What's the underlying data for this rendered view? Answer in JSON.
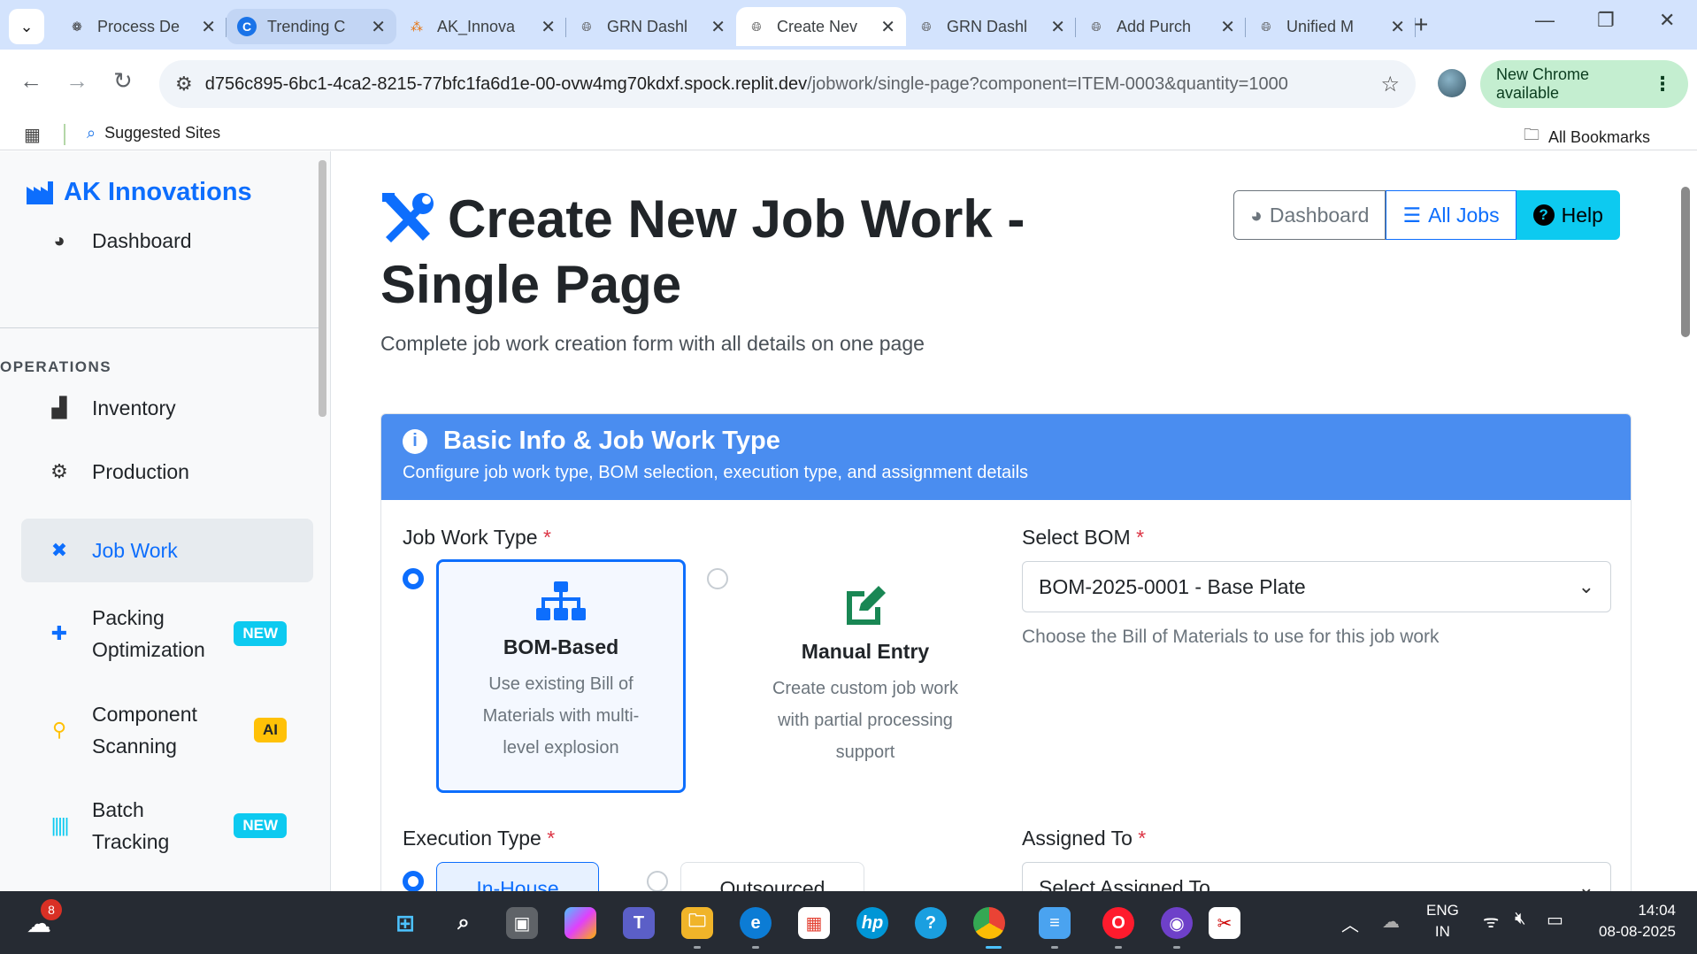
{
  "browser": {
    "tabs": [
      {
        "title": "Process De",
        "icon": "chatgpt-icon"
      },
      {
        "title": "Trending C",
        "icon": "c-logo-icon"
      },
      {
        "title": "AK_Innova",
        "icon": "figma-icon"
      },
      {
        "title": "GRN Dashl",
        "icon": "globe-icon"
      },
      {
        "title": "Create Nev",
        "icon": "globe-icon"
      },
      {
        "title": "GRN Dashl",
        "icon": "globe-icon"
      },
      {
        "title": "Add Purch",
        "icon": "globe-icon"
      },
      {
        "title": "Unified M",
        "icon": "globe-icon"
      }
    ],
    "url_host": "d756c895-6bc1-4ca2-8215-77bfc1fa6d1e-00-ovw4mg70kdxf.spock.replit.dev",
    "url_path": "/jobwork/single-page?component=ITEM-0003&quantity=1000",
    "update_label": "New Chrome available",
    "bookmarks": {
      "suggested": "Suggested Sites",
      "all": "All Bookmarks"
    }
  },
  "sidebar": {
    "brand": "AK Innovations",
    "dashboard": "Dashboard",
    "section": "OPERATIONS",
    "items": [
      {
        "label": "Inventory",
        "icon": "boxes-icon"
      },
      {
        "label": "Production",
        "icon": "cogs-icon"
      },
      {
        "label": "Job Work",
        "icon": "tools-icon"
      },
      {
        "label": "Packing Optimization",
        "badge": "NEW",
        "icon": "puzzle-icon"
      },
      {
        "label": "Component Scanning",
        "badge": "AI",
        "icon": "search-icon"
      },
      {
        "label": "Batch Tracking",
        "badge": "NEW",
        "icon": "barcode-icon"
      }
    ]
  },
  "header": {
    "title": "Create New Job Work - Single Page",
    "subtitle": "Complete job work creation form with all details on one page",
    "buttons": {
      "dashboard": "Dashboard",
      "all_jobs": "All Jobs",
      "help": "Help"
    }
  },
  "card": {
    "title": "Basic Info & Job Work Type",
    "subtitle": "Configure job work type, BOM selection, execution type, and assignment details"
  },
  "form": {
    "job_work_type_label": "Job Work Type",
    "bom_option": {
      "title": "BOM-Based",
      "desc": "Use existing Bill of Materials with multi-level explosion"
    },
    "manual_option": {
      "title": "Manual Entry",
      "desc": "Create custom job work with partial processing support"
    },
    "select_bom_label": "Select BOM",
    "select_bom_value": "BOM-2025-0001 - Base Plate",
    "select_bom_hint": "Choose the Bill of Materials to use for this job work",
    "execution_type_label": "Execution Type",
    "in_house": "In-House",
    "outsourced": "Outsourced",
    "assigned_to_label": "Assigned To",
    "assigned_to_placeholder": "Select Assigned To",
    "required_mark": "*"
  },
  "taskbar": {
    "weather_count": "8",
    "lang_top": "ENG",
    "lang_bottom": "IN",
    "time": "14:04",
    "date": "08-08-2025"
  },
  "colors": {
    "primary": "#0d6efd",
    "info": "#0dcaf0",
    "warning": "#ffc107",
    "card_header": "#4a8df0",
    "success": "#198754"
  }
}
